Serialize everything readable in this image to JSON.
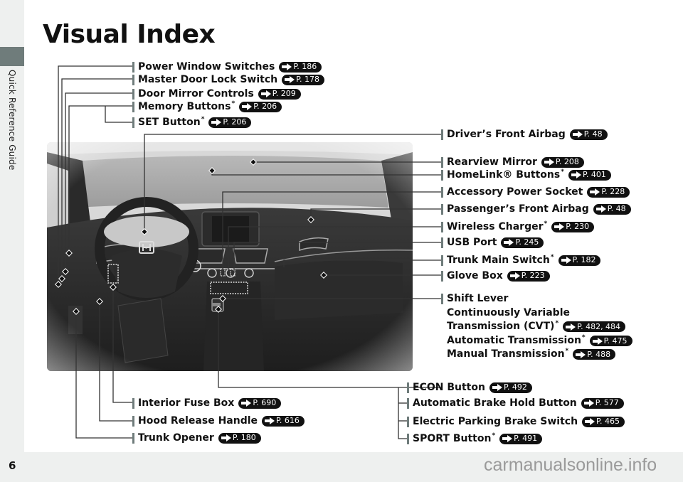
{
  "sidebar": {
    "section_label": "Quick Reference Guide"
  },
  "page": {
    "title": "Visual Index",
    "number": "6"
  },
  "footer": {
    "watermark": "carmanualsonline.info"
  },
  "photo": {
    "description": "Car dashboard interior",
    "icon": "honda-logo-icon"
  },
  "callouts_left_top": [
    {
      "label": "Power Window Switches",
      "ref": "P. 186",
      "asterisk": false
    },
    {
      "label": "Master Door Lock Switch",
      "ref": "P. 178",
      "asterisk": false
    },
    {
      "label": "Door Mirror Controls",
      "ref": "P. 209",
      "asterisk": false
    },
    {
      "label": "Memory Buttons",
      "ref": "P. 206",
      "asterisk": true
    },
    {
      "label": "SET Button",
      "ref": "P. 206",
      "asterisk": true
    }
  ],
  "callouts_right": [
    {
      "label": "Driver’s Front Airbag",
      "ref": "P. 48",
      "asterisk": false
    },
    {
      "label": "Rearview Mirror",
      "ref": "P. 208",
      "asterisk": false
    },
    {
      "label": "HomeLink® Buttons",
      "ref": "P. 401",
      "asterisk": true
    },
    {
      "label": "Accessory Power Socket",
      "ref": "P. 228",
      "asterisk": false
    },
    {
      "label": "Passenger’s Front Airbag",
      "ref": "P. 48",
      "asterisk": false
    },
    {
      "label": "Wireless Charger",
      "ref": "P. 230",
      "asterisk": true
    },
    {
      "label": "USB Port",
      "ref": "P. 245",
      "asterisk": false
    },
    {
      "label": "Trunk Main Switch",
      "ref": "P. 182",
      "asterisk": true
    },
    {
      "label": "Glove Box",
      "ref": "P. 223",
      "asterisk": false
    }
  ],
  "shift_lever": {
    "label": "Shift Lever",
    "items": [
      {
        "label": "Continuously Variable",
        "ref": null,
        "asterisk": false
      },
      {
        "label": "Transmission (CVT)",
        "ref": "P. 482, 484",
        "asterisk": true
      },
      {
        "label": "Automatic Transmission",
        "ref": "P. 475",
        "asterisk": true
      },
      {
        "label": "Manual Transmission",
        "ref": "P. 488",
        "asterisk": true
      }
    ]
  },
  "callouts_bottom_right": [
    {
      "label": "ECON Button",
      "ref": "P. 492",
      "asterisk": false
    },
    {
      "label": "Automatic Brake Hold Button",
      "ref": "P. 577",
      "asterisk": false
    },
    {
      "label": "Electric Parking Brake Switch",
      "ref": "P. 465",
      "asterisk": false
    },
    {
      "label": "SPORT Button",
      "ref": "P. 491",
      "asterisk": true
    }
  ],
  "callouts_bottom_left": [
    {
      "label": "Interior Fuse Box",
      "ref": "P. 690",
      "asterisk": false
    },
    {
      "label": "Hood Release Handle",
      "ref": "P. 616",
      "asterisk": false
    },
    {
      "label": "Trunk Opener",
      "ref": "P. 180",
      "asterisk": false
    }
  ],
  "asterisk_symbol": "*"
}
